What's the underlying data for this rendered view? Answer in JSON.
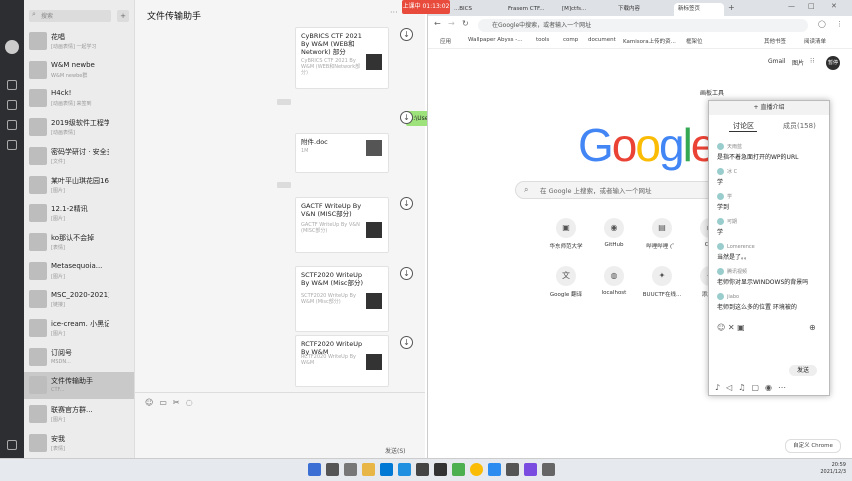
{
  "recording": {
    "label": "上课中 01:13:02"
  },
  "contacts": [
    {
      "name": "花唱",
      "preview": "[动画表情] 一起学习",
      "time": ""
    },
    {
      "name": "W&M newbe",
      "preview": "W&M newbe群",
      "time": ""
    },
    {
      "name": "H4ck!",
      "preview": "[动画表情] 来签到",
      "time": ""
    },
    {
      "name": "2019级软件工程学院",
      "preview": "[动画表情]",
      "time": ""
    },
    {
      "name": "密码学研讨 · 安全多方",
      "preview": "[文件]",
      "time": ""
    },
    {
      "name": "某叶平山琪花园16-...",
      "preview": "[图片]",
      "time": ""
    },
    {
      "name": "12.1-2精讯",
      "preview": "[图片]",
      "time": ""
    },
    {
      "name": "ko那认不会掉",
      "preview": "[表情]",
      "time": ""
    },
    {
      "name": "Metasequoia...",
      "preview": "[图片]",
      "time": ""
    },
    {
      "name": "MSC_2020-2021主席群",
      "preview": "[链接]",
      "time": ""
    },
    {
      "name": "ice-cream. 小黑记账、东...",
      "preview": "[图片]",
      "time": ""
    },
    {
      "name": "订阅号",
      "preview": "MSDN...",
      "time": ""
    },
    {
      "name": "文件传输助手",
      "preview": "CTF...",
      "time": ""
    },
    {
      "name": "联赛官方群...",
      "preview": "[图片]",
      "time": ""
    },
    {
      "name": "安我",
      "preview": "[表情]",
      "time": ""
    }
  ],
  "chat": {
    "title": "文件传输助手",
    "send_label": "发送(S)",
    "path_message": "C:\\Users\\yocz\\Desktop\\附件.doc",
    "cards": [
      {
        "title": "CyBRICS CTF 2021 By W&M (WEB和Network) 部分",
        "sub": "CyBRICS CTF 2021 By W&M (WEB和Network部分)"
      },
      {
        "title": "附件.doc",
        "sub": "1M"
      },
      {
        "title": "GACTF WriteUp By V&N (MISC部分)",
        "sub": "GACTF WriteUp By V&N (MISC部分)"
      },
      {
        "title": "SCTF2020 WriteUp By W&M (Misc部分)",
        "sub": "SCTF2020 WriteUp By W&M (Misc部分)"
      },
      {
        "title": "RCTF2020 WriteUp By W&M",
        "sub": "RCTF2020 WriteUp By W&M"
      }
    ]
  },
  "browser": {
    "tabs": [
      "...BICS",
      "Frasem CTF...",
      "[M]ctfs...",
      "下载内容",
      "新标签页"
    ],
    "omnibox": "在Google中搜索，或者输入一个网址",
    "bookmarks": [
      "应用",
      "Wallpaper Abyss -...",
      "tools",
      "comp",
      "document",
      "Kamisora上传的资...",
      "框架位",
      "其他书签",
      "阅读清单"
    ],
    "top_links": [
      "Gmail",
      "图片"
    ],
    "avatar_label": "暂停",
    "logo_letters": [
      "G",
      "o",
      "o",
      "g",
      "l",
      "e"
    ],
    "logo_colors": [
      "#4285f4",
      "#ea4335",
      "#fbbc05",
      "#4285f4",
      "#34a853",
      "#ea4335"
    ],
    "search_placeholder": "在 Google 上搜索，或者输入一个网址",
    "shortcuts": [
      {
        "label": "华东师范大学",
        "icon": "ecnu-icon"
      },
      {
        "label": "GitHub",
        "icon": "github-icon"
      },
      {
        "label": "哔哩哔哩 (゜",
        "icon": "bilibili-icon"
      },
      {
        "label": "Cyb",
        "icon": "globe-icon"
      },
      {
        "label": "Google 翻译",
        "icon": "translate-icon"
      },
      {
        "label": "localhost",
        "icon": "globe-icon"
      },
      {
        "label": "BUUCTF在线...",
        "icon": "buu-icon"
      },
      {
        "label": "添加快",
        "icon": "plus-icon"
      }
    ],
    "customize_label": "自定义 Chrome"
  },
  "live_panel": {
    "header": "画板工具",
    "top_label": "+ 直播介绍",
    "tabs": [
      "讨论区",
      "成员(158)"
    ],
    "comments": [
      {
        "user": "天雨蓝",
        "text": "是指不着急面打开的WP的URL"
      },
      {
        "user": "冰 C",
        "text": "学"
      },
      {
        "user": "学",
        "text": "学到"
      },
      {
        "user": "可期",
        "text": "学"
      },
      {
        "user": "Lomerence",
        "text": "当然是了。。"
      },
      {
        "user": "腾讯视频",
        "text": "老师你对显示WINDOWS的背景吗"
      },
      {
        "user": "jiabo",
        "text": "老师到这么多的位置 环境被的"
      }
    ],
    "send_label": "发送"
  },
  "clock": {
    "time": "20:59",
    "date": "2021/12/3"
  }
}
